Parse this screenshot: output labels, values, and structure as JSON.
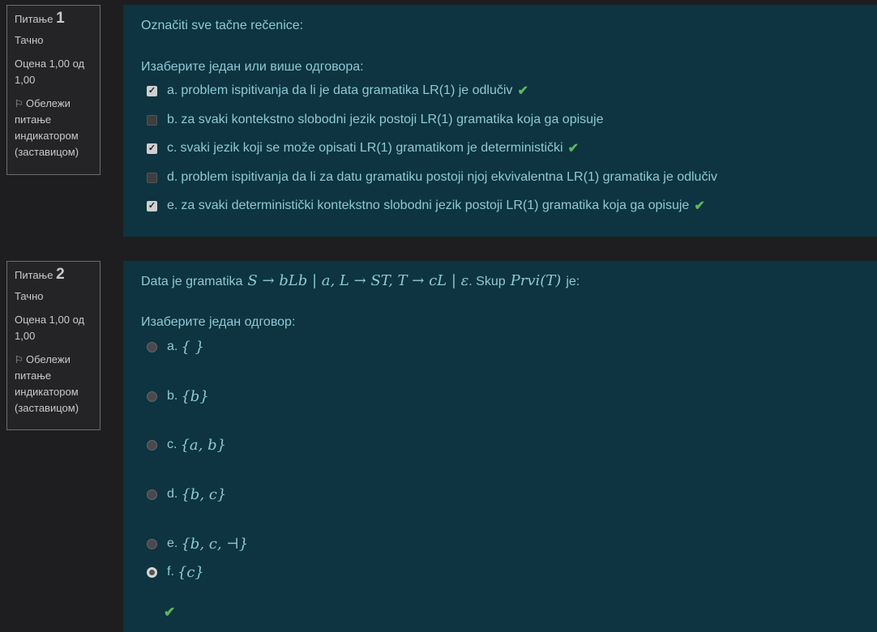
{
  "questions": [
    {
      "label": "Питање",
      "number": "1",
      "state": "Тачно",
      "grade": "Оцена 1,00 од 1,00",
      "flag": "Обележи питање индикатором (заставицом)",
      "text": "Označiti sve tačne rečenice:",
      "prompt": "Изаберите један или више одговора:",
      "options": [
        {
          "letter": "a.",
          "text": "problem ispitivanja da li je data gramatika LR(1) je odlučiv",
          "checked": true,
          "correct": true
        },
        {
          "letter": "b.",
          "text": "za svaki kontekstno slobodni jezik postoji LR(1) gramatika koja ga opisuje",
          "checked": false,
          "correct": false
        },
        {
          "letter": "c.",
          "text": "svaki jezik koji se može opisati LR(1) gramatikom je deterministički",
          "checked": true,
          "correct": true
        },
        {
          "letter": "d.",
          "text": "problem ispitivanja da li za datu gramatiku postoji njoj ekvivalentna LR(1) gramatika je odlučiv",
          "checked": false,
          "correct": false
        },
        {
          "letter": "e.",
          "text": "za svaki deterministički kontekstno slobodni jezik postoji LR(1) gramatika koja ga opisuje",
          "checked": true,
          "correct": true
        }
      ]
    },
    {
      "label": "Питање",
      "number": "2",
      "state": "Тачно",
      "grade": "Оцена 1,00 од 1,00",
      "flag": "Обележи питање индикатором (заставицом)",
      "text_prefix": "Data je gramatika",
      "text_math": "S → bLb | a, L → ST, T → cL | ε",
      "text_middle": ". Skup",
      "text_math2": "Prvi(T)",
      "text_suffix": "je:",
      "prompt": "Изаберите један одговор:",
      "options": [
        {
          "letter": "a.",
          "math": "{ }",
          "checked": false
        },
        {
          "letter": "b.",
          "math": "{b}",
          "checked": false
        },
        {
          "letter": "c.",
          "math": "{a, b}",
          "checked": false
        },
        {
          "letter": "d.",
          "math": "{b, c}",
          "checked": false
        },
        {
          "letter": "e.",
          "math": "{b, c, ⊣}",
          "checked": false
        },
        {
          "letter": "f.",
          "math": "{c}",
          "checked": true
        }
      ]
    }
  ],
  "colors": {
    "tick": "#5cb85c",
    "content_bg": "#0d3440",
    "text": "#8fc9d6"
  }
}
